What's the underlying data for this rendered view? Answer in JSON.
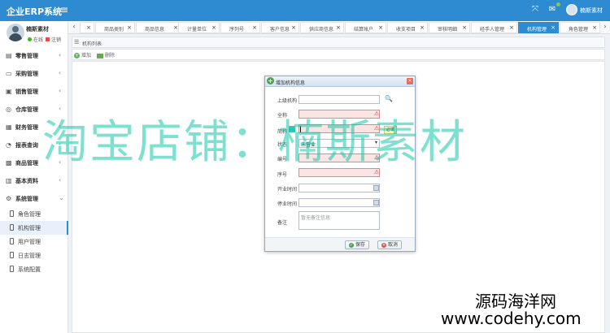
{
  "app": {
    "title": "企业ERP系统",
    "user": "楠斯素材"
  },
  "topbar": {
    "icons": [
      "menu-icon",
      "fullscreen-icon",
      "message-icon"
    ]
  },
  "user_panel": {
    "name": "楠斯素材",
    "status": "在线",
    "logout": "注销"
  },
  "sidebar": {
    "items": [
      {
        "label": "零售管理",
        "icon": "retail-icon"
      },
      {
        "label": "采购管理",
        "icon": "purchase-icon"
      },
      {
        "label": "销售管理",
        "icon": "sales-icon"
      },
      {
        "label": "仓库管理",
        "icon": "warehouse-icon"
      },
      {
        "label": "财务管理",
        "icon": "finance-icon"
      },
      {
        "label": "报表查询",
        "icon": "report-icon"
      },
      {
        "label": "商品管理",
        "icon": "goods-icon"
      },
      {
        "label": "基本资料",
        "icon": "basic-icon"
      },
      {
        "label": "系统管理",
        "icon": "system-icon"
      }
    ],
    "sub_items": [
      {
        "label": "角色管理"
      },
      {
        "label": "机构管理",
        "active": true
      },
      {
        "label": "用户管理"
      },
      {
        "label": "日志管理"
      },
      {
        "label": "系统配置"
      }
    ]
  },
  "tabs": [
    {
      "label": ""
    },
    {
      "label": "商品类别"
    },
    {
      "label": "商品信息"
    },
    {
      "label": "计量单位"
    },
    {
      "label": "序列号"
    },
    {
      "label": "客户信息"
    },
    {
      "label": "供应商信息"
    },
    {
      "label": "结算账户"
    },
    {
      "label": "收支项目"
    },
    {
      "label": "审核明细"
    },
    {
      "label": "经手人管理"
    },
    {
      "label": "机构管理",
      "active": true
    },
    {
      "label": "角色管理"
    }
  ],
  "panel": {
    "title": "机构列表"
  },
  "toolbar": {
    "add": "增加",
    "delete": "删除"
  },
  "dialog": {
    "title": "增加机构信息",
    "fields": [
      {
        "label": "上级机构",
        "value": ""
      },
      {
        "label": "全称",
        "value": ""
      },
      {
        "label": "简称",
        "value": ""
      },
      {
        "label": "状态",
        "value": "未营业"
      },
      {
        "label": "编号",
        "value": ""
      },
      {
        "label": "序号",
        "value": ""
      },
      {
        "label": "开业时间",
        "value": ""
      },
      {
        "label": "停业时间",
        "value": ""
      },
      {
        "label": "备注",
        "placeholder": "暂无备注信息"
      }
    ],
    "tooltip": "必填",
    "save": "保存",
    "cancel": "取消"
  },
  "watermarks": {
    "big": "淘宝店铺：楠斯素材",
    "site_name": "源码海洋网",
    "site_url": "www.codehy.com"
  },
  "colors": {
    "primary": "#2e8bd1",
    "required_bg": "#fbe4e4",
    "watermark": "#14c8aa"
  }
}
